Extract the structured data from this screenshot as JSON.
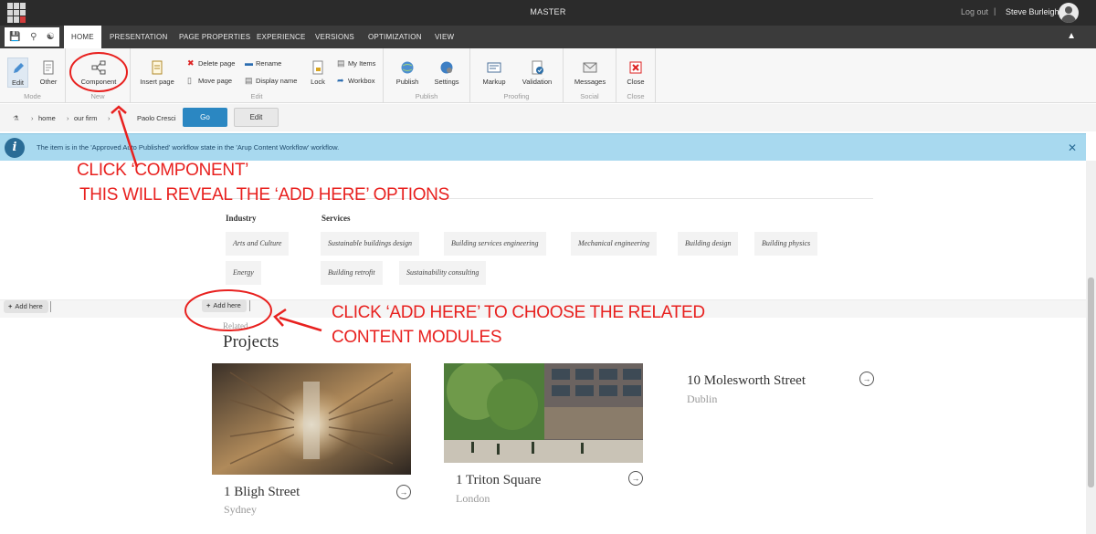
{
  "app": {
    "title": "MASTER",
    "logout_label": "Log out",
    "separator": "|",
    "user_name": "Steve Burleigh"
  },
  "tabs": [
    "HOME",
    "PRESENTATION",
    "PAGE PROPERTIES",
    "EXPERIENCE",
    "VERSIONS",
    "OPTIMIZATION",
    "VIEW"
  ],
  "ribbon": {
    "mode": {
      "label": "Mode",
      "edit": "Edit",
      "other": "Other"
    },
    "new": {
      "label": "New",
      "component": "Component"
    },
    "edit": {
      "label": "Edit",
      "insert_page": "Insert page",
      "delete_page": "Delete page",
      "move_page": "Move page",
      "rename": "Rename",
      "display_name": "Display name",
      "lock": "Lock",
      "my_items": "My Items",
      "workbox": "Workbox"
    },
    "publish": {
      "label": "Publish",
      "publish": "Publish",
      "settings": "Settings"
    },
    "proofing": {
      "label": "Proofing",
      "markup": "Markup",
      "validation": "Validation"
    },
    "social": {
      "label": "Social",
      "messages": "Messages"
    },
    "close": {
      "label": "Close",
      "close": "Close"
    }
  },
  "breadcrumb": {
    "items": [
      "home",
      "our firm",
      "Paolo Cresci"
    ],
    "go_label": "Go",
    "edit_label": "Edit"
  },
  "notification": {
    "message": "The item is in the 'Approved Auto Published' workflow state in the 'Arup Content Workflow' workflow."
  },
  "annotations": {
    "line1": "CLICK ‘COMPONENT’",
    "line2": "THIS WILL REVEAL THE ‘ADD HERE’ OPTIONS",
    "line3": "CLICK ‘ADD HERE’ TO CHOOSE THE RELATED",
    "line4": "CONTENT MODULES"
  },
  "tags": {
    "industry_heading": "Industry",
    "services_heading": "Services",
    "industry": [
      "Arts and Culture",
      "Energy"
    ],
    "services": [
      "Sustainable buildings design",
      "Building services engineering",
      "Mechanical engineering",
      "Building design",
      "Building physics",
      "Building retrofit",
      "Sustainability consulting"
    ]
  },
  "add_here_label": "Add here",
  "related": {
    "kicker": "Related",
    "heading": "Projects"
  },
  "projects": [
    {
      "name": "1 Bligh Street",
      "city": "Sydney"
    },
    {
      "name": "1 Triton Square",
      "city": "London"
    },
    {
      "name": "10 Molesworth Street",
      "city": "Dublin"
    }
  ],
  "colors": {
    "annotation": "#e8211f",
    "accent": "#2b87c2",
    "notice": "#a8d9ef"
  }
}
